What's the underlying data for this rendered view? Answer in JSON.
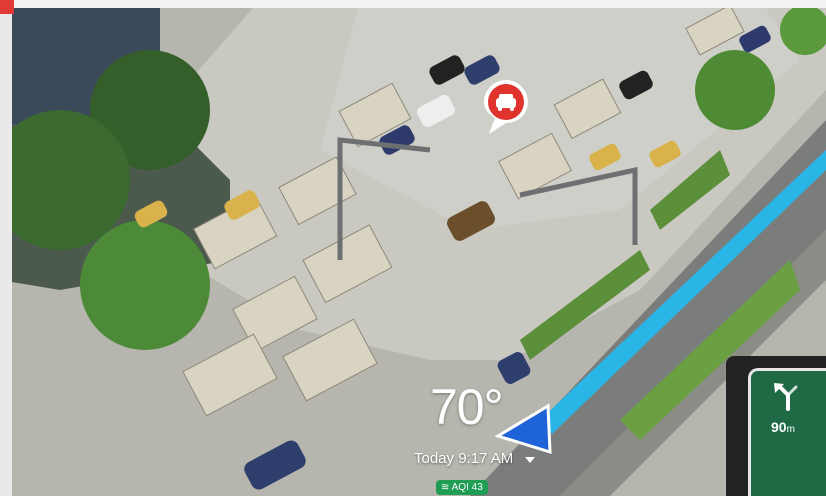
{
  "weather": {
    "temperature": "70°",
    "time": "Today 9:17 AM",
    "aqi": "AQI 43"
  },
  "navigation": {
    "distance_value": "90",
    "distance_unit": "m"
  },
  "icons": [
    "traffic-alert-icon",
    "turn-left-arrow-icon",
    "vehicle-position-arrow-icon",
    "chevron-down-icon",
    "aqi-icon"
  ]
}
